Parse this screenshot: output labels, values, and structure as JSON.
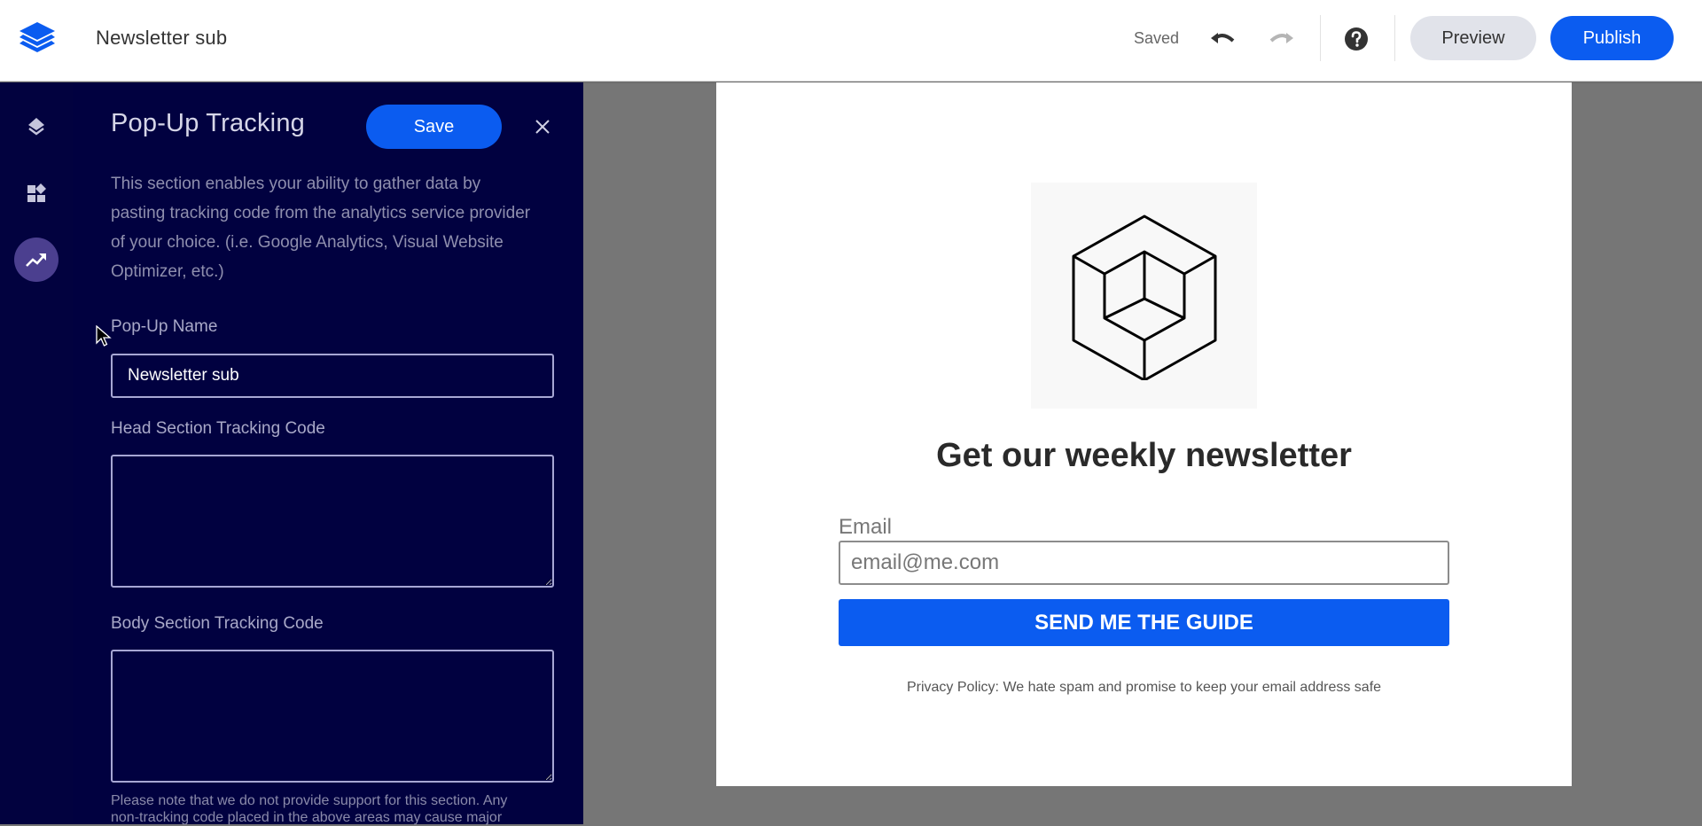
{
  "header": {
    "title": "Newsletter sub",
    "status": "Saved",
    "preview_label": "Preview",
    "publish_label": "Publish",
    "icons": {
      "logo": "layers-logo-icon",
      "undo": "undo-icon",
      "redo": "redo-icon",
      "help": "help-icon"
    },
    "colors": {
      "accent": "#0b5cf0",
      "preview_bg": "#e1e3ea"
    }
  },
  "nav": {
    "items": [
      {
        "name": "layers",
        "icon": "layers-icon",
        "active": false
      },
      {
        "name": "widgets",
        "icon": "widgets-icon",
        "active": false
      },
      {
        "name": "tracking",
        "icon": "trending-up-icon",
        "active": true
      }
    ],
    "colors": {
      "background": "#02023f",
      "active": "#4b3f8f"
    }
  },
  "panel": {
    "title": "Pop-Up Tracking",
    "save_label": "Save",
    "description": "This section enables your ability to gather data by pasting tracking code from the analytics service provider of your choice. (i.e. Google Analytics, Visual Website Optimizer, etc.)",
    "fields": {
      "name": {
        "label": "Pop-Up Name",
        "value": "Newsletter sub"
      },
      "head_code": {
        "label": "Head Section Tracking Code",
        "value": ""
      },
      "body_code": {
        "label": "Body Section Tracking Code",
        "value": ""
      }
    },
    "note": "Please note that we do not provide support for this section. Any non-tracking code placed in the above areas may cause major",
    "colors": {
      "background": "#010140"
    }
  },
  "popup": {
    "heading": "Get our weekly newsletter",
    "email_label": "Email",
    "email_placeholder": "email@me.com",
    "cta_label": "SEND ME THE GUIDE",
    "privacy": "Privacy Policy: We hate spam and promise to keep your email address safe",
    "image_icon": "isometric-cube-icon",
    "colors": {
      "cta": "#0b5cf0",
      "canvas": "#767676"
    }
  }
}
